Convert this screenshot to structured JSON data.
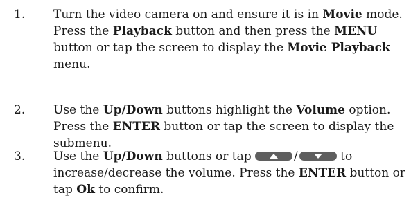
{
  "steps": [
    {
      "number": "1.",
      "parts": {
        "p1": "Turn the video camera on and ensure it is in ",
        "b1": "Movie",
        "p2": " mode. Press the ",
        "b2": "Playback",
        "p3": " button and then press the ",
        "b3": "MENU",
        "p4": " button or tap the screen to display the ",
        "b4": "Movie Playback",
        "p5": " menu."
      }
    },
    {
      "number": "2.",
      "parts": {
        "p1": "Use the ",
        "b1": "Up/Down",
        "p2": " buttons highlight the ",
        "b2": "Volume",
        "p3": " option. Press the ",
        "b3": "ENTER",
        "p4": " button or tap the screen to display the submenu."
      }
    },
    {
      "number": "3.",
      "parts": {
        "p1": "Use the ",
        "b1": "Up/Down",
        "p2": " buttons or tap ",
        "slash": "/",
        "p3": " to increase/decrease the volume. Press the ",
        "b2": "ENTER",
        "p4": " button or tap ",
        "b3": "Ok",
        "p5": " to confirm."
      },
      "icons": [
        "up-arrow-button-icon",
        "down-arrow-button-icon"
      ]
    }
  ],
  "colors": {
    "text": "#1a1a1a",
    "button_fill": "#5f5f5f",
    "arrow_fill": "#ffffff"
  }
}
